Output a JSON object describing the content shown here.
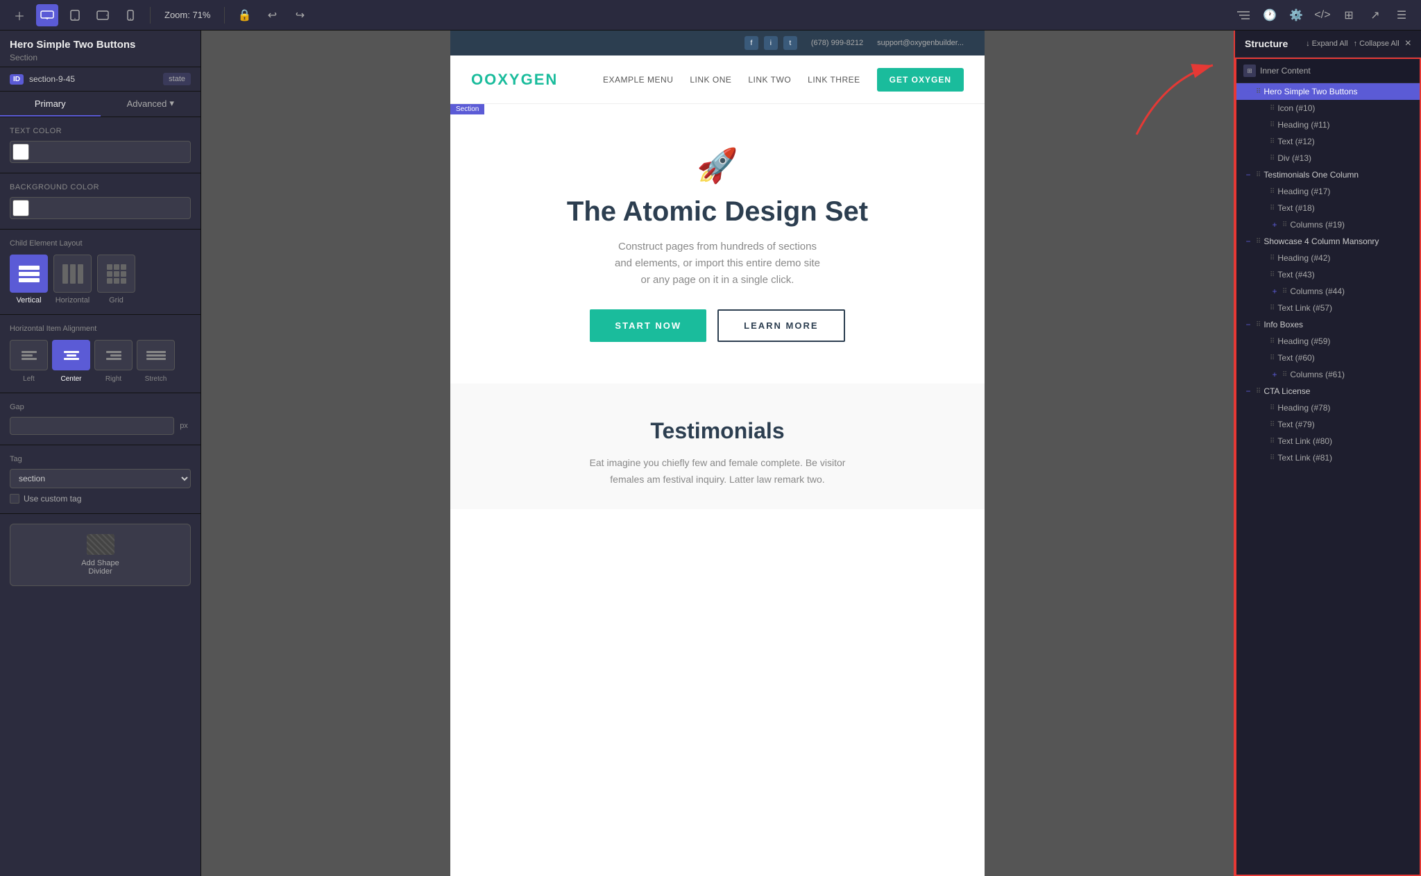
{
  "topbar": {
    "title": "Hero Simple Two Buttons",
    "subtitle": "Section",
    "zoom": "Zoom: 71%",
    "id_value": "section-9-45",
    "id_label": "ID",
    "state_label": "state",
    "expand_label": "↓ Expand All",
    "collapse_label": "↑ Collapse All",
    "close_label": "×"
  },
  "left_panel": {
    "title": "Hero Simple Two Buttons",
    "subtitle": "Section",
    "tabs": {
      "primary": "Primary",
      "advanced": "Advanced"
    },
    "text_color_label": "Text Color",
    "bg_color_label": "Background Color",
    "child_layout_label": "Child Element Layout",
    "layout_options": [
      {
        "label": "Vertical",
        "active": true
      },
      {
        "label": "Horizontal",
        "active": false
      },
      {
        "label": "Grid",
        "active": false
      }
    ],
    "align_label": "Horizontal Item Alignment",
    "align_options": [
      {
        "label": "Left",
        "active": false
      },
      {
        "label": "Center",
        "active": true
      },
      {
        "label": "Right",
        "active": false
      },
      {
        "label": "Stretch",
        "active": false
      }
    ],
    "gap_label": "Gap",
    "gap_unit": "px",
    "tag_label": "Tag",
    "tag_value": "section",
    "custom_tag_label": "Use custom tag",
    "shape_divider_label": "Add Shape\nDivider"
  },
  "canvas": {
    "topbar": {
      "phone": "(678) 999-8212",
      "email": "support@oxygenbuilder...",
      "social": [
        "f",
        "i",
        "t"
      ]
    },
    "nav": {
      "logo": "OXYGEN",
      "links": [
        "EXAMPLE MENU",
        "LINK ONE",
        "LINK TWO",
        "LINK THREE"
      ],
      "cta": "GET OXYGEN"
    },
    "section_badge": "Section",
    "hero": {
      "icon": "🚀",
      "title": "The Atomic Design Set",
      "description": "Construct pages from hundreds of sections\nand elements, or import this entire demo site\nor any page on it in a single click.",
      "btn_primary": "START NOW",
      "btn_secondary": "LEARN MORE"
    },
    "testimonials": {
      "title": "Testimonials",
      "description": "Eat imagine you chiefly few and female complete. Be visitor females am festival inquiry. Latter law remark two."
    }
  },
  "structure": {
    "title": "Structure",
    "inner_content": "Inner Content",
    "items": [
      {
        "label": "Hero Simple Two Buttons",
        "level": 1,
        "type": "section",
        "selected": true,
        "toggle": "minus"
      },
      {
        "label": "Icon (#10)",
        "level": 2,
        "toggle": "none"
      },
      {
        "label": "Heading (#11)",
        "level": 2,
        "toggle": "none"
      },
      {
        "label": "Text (#12)",
        "level": 2,
        "toggle": "none"
      },
      {
        "label": "Div (#13)",
        "level": 2,
        "toggle": "none"
      },
      {
        "label": "Testimonials One Column",
        "level": 1,
        "type": "section",
        "toggle": "minus"
      },
      {
        "label": "Heading (#17)",
        "level": 2,
        "toggle": "none"
      },
      {
        "label": "Text (#18)",
        "level": 2,
        "toggle": "none"
      },
      {
        "label": "Columns (#19)",
        "level": 2,
        "toggle": "plus"
      },
      {
        "label": "Showcase 4 Column Mansonry",
        "level": 1,
        "type": "section",
        "toggle": "minus"
      },
      {
        "label": "Heading (#42)",
        "level": 2,
        "toggle": "none"
      },
      {
        "label": "Text (#43)",
        "level": 2,
        "toggle": "none"
      },
      {
        "label": "Columns (#44)",
        "level": 2,
        "toggle": "plus"
      },
      {
        "label": "Text Link (#57)",
        "level": 2,
        "toggle": "none"
      },
      {
        "label": "Info Boxes",
        "level": 1,
        "type": "section",
        "toggle": "minus"
      },
      {
        "label": "Heading (#59)",
        "level": 2,
        "toggle": "none"
      },
      {
        "label": "Text (#60)",
        "level": 2,
        "toggle": "none"
      },
      {
        "label": "Columns (#61)",
        "level": 2,
        "toggle": "plus"
      },
      {
        "label": "CTA License",
        "level": 1,
        "type": "section",
        "toggle": "minus"
      },
      {
        "label": "Heading (#78)",
        "level": 2,
        "toggle": "none"
      },
      {
        "label": "Text (#79)",
        "level": 2,
        "toggle": "none"
      },
      {
        "label": "Text Link (#80)",
        "level": 2,
        "toggle": "none"
      },
      {
        "label": "Text Link (#81)",
        "level": 2,
        "toggle": "none"
      }
    ]
  }
}
